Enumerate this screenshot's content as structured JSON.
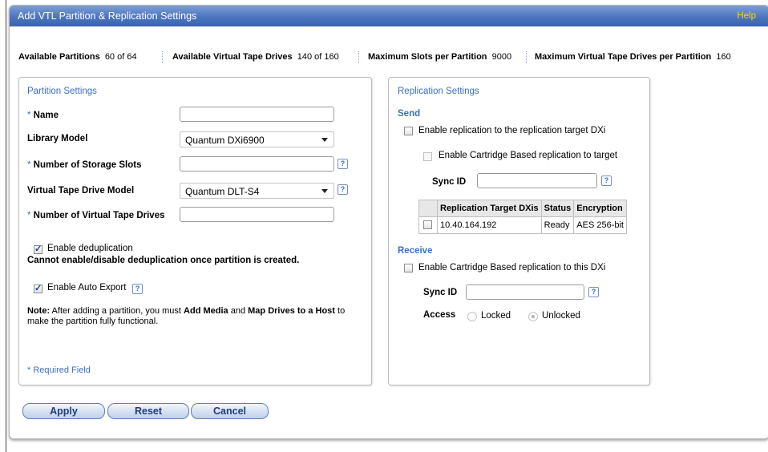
{
  "window": {
    "title": "Add VTL Partition & Replication Settings",
    "help": "Help"
  },
  "info": {
    "available_partitions_label": "Available Partitions",
    "available_partitions_value": "60 of 64",
    "available_drives_label": "Available Virtual Tape Drives",
    "available_drives_value": "140 of 160",
    "max_slots_label": "Maximum Slots per Partition",
    "max_slots_value": "9000",
    "max_drives_label": "Maximum Virtual Tape Drives per Partition",
    "max_drives_value": "160"
  },
  "partition": {
    "title": "Partition Settings",
    "name_label": "Name",
    "name_value": "",
    "library_model_label": "Library Model",
    "library_model_value": "Quantum DXi6900",
    "storage_slots_label": "Number of Storage Slots",
    "storage_slots_value": "",
    "drive_model_label": "Virtual Tape Drive Model",
    "drive_model_value": "Quantum DLT-S4",
    "drive_count_label": "Number of Virtual Tape Drives",
    "drive_count_value": "",
    "dedup_label": "Enable deduplication",
    "dedup_checked": true,
    "dedup_warning": "Cannot enable/disable deduplication once partition is created.",
    "auto_export_label": "Enable Auto Export",
    "auto_export_checked": true,
    "note_prefix": "Note:",
    "note_text1": " After adding a partition, you must ",
    "note_add_media": "Add Media",
    "note_text2": " and ",
    "note_map_drives": "Map Drives to a Host",
    "note_text3": " to",
    "note_line2": "make the partition fully functional.",
    "required_note": "* Required Field"
  },
  "replication": {
    "title": "Replication Settings",
    "send_label": "Send",
    "enable_replication_label": "Enable replication to the replication target DXi",
    "enable_cartridge_label": "Enable Cartridge Based replication to target",
    "sync_id_label": "Sync ID",
    "sync_id_value": "",
    "table": {
      "headers": [
        "",
        "Replication Target DXis",
        "Status",
        "Encryption"
      ],
      "rows": [
        {
          "target": "10.40.164.192",
          "status": "Ready",
          "encryption": "AES 256-bit"
        }
      ]
    },
    "receive_label": "Receive",
    "enable_receive_label": "Enable Cartridge Based replication to this DXi",
    "receive_sync_id_label": "Sync ID",
    "receive_sync_id_value": "",
    "access_label": "Access",
    "access_locked": "Locked",
    "access_unlocked": "Unlocked",
    "access_selected": "Unlocked"
  },
  "buttons": {
    "apply": "Apply",
    "reset": "Reset",
    "cancel": "Cancel"
  },
  "colors": {
    "title_bar": "#4c74bf",
    "help_link": "#ffd400",
    "section_title": "#3a6fc4",
    "button_text": "#1f3d7a"
  },
  "icons": {
    "help": "question-mark-icon"
  },
  "icon_glyphs": {
    "help": "?"
  }
}
